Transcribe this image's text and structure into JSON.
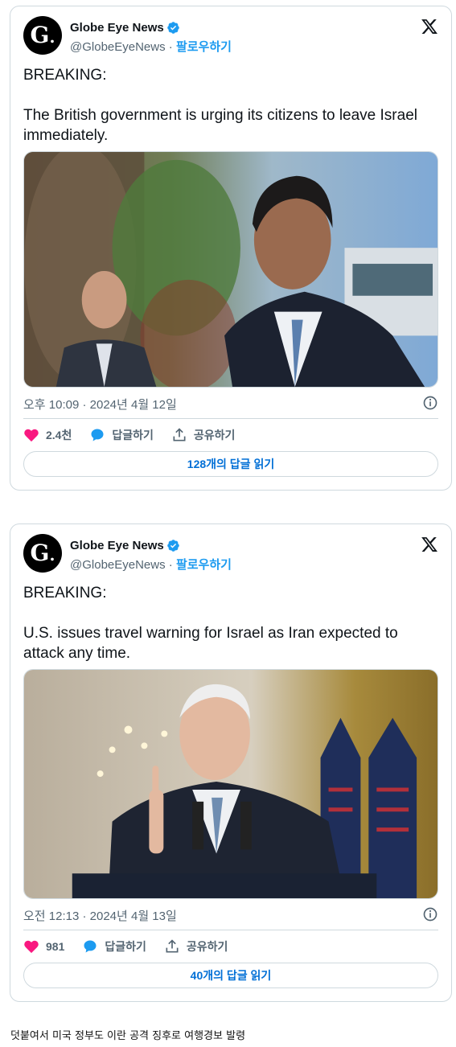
{
  "tweets": [
    {
      "author": {
        "display_name": "Globe Eye News",
        "handle": "@GlobeEyeNews",
        "separator": " · ",
        "follow_label": "팔로우하기",
        "avatar_letter": "G"
      },
      "text": "BREAKING:\n\nThe British government is urging its citizens to leave Israel immediately.",
      "timestamp": "오후 10:09 · 2024년 4월 12일",
      "likes": "2.4천",
      "reply_label": "답글하기",
      "share_label": "공유하기",
      "read_replies": "128개의 답글 읽기"
    },
    {
      "author": {
        "display_name": "Globe Eye News",
        "handle": "@GlobeEyeNews",
        "separator": " · ",
        "follow_label": "팔로우하기",
        "avatar_letter": "G"
      },
      "text": "BREAKING:\n\nU.S. issues travel warning for Israel as Iran expected to attack any time.",
      "timestamp": "오전 12:13 · 2024년 4월 13일",
      "likes": "981",
      "reply_label": "답글하기",
      "share_label": "공유하기",
      "read_replies": "40개의 답글 읽기"
    }
  ],
  "footer_note": "덧붙여서 미국 정부도 이란 공격 징후로 여행경보 발령",
  "colors": {
    "accent": "#1d9bf0",
    "like": "#f91880",
    "link": "#006fd6",
    "muted": "#536471",
    "border": "#cfd9de"
  },
  "icons": [
    "verified-badge-icon",
    "x-logo-icon",
    "info-icon",
    "heart-icon",
    "reply-bubble-icon",
    "share-icon"
  ]
}
